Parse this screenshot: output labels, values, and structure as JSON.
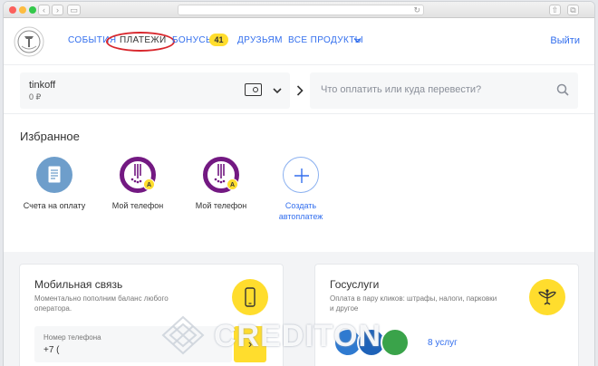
{
  "nav": {
    "items": [
      {
        "label": "События",
        "active": false
      },
      {
        "label": "Платежи",
        "active": true
      },
      {
        "label": "Бонусы",
        "active": false
      },
      {
        "label": "Друзьям",
        "active": false
      },
      {
        "label": "Все продукты",
        "active": false
      }
    ],
    "bonus_count": "41",
    "logout": "Выйти"
  },
  "account": {
    "name": "tinkoff",
    "balance": "0 ₽"
  },
  "search": {
    "placeholder": "Что оплатить или куда перевести?"
  },
  "favorites": {
    "title": "Избранное",
    "items": [
      {
        "label": "Счета на оплату",
        "icon": "invoice-icon"
      },
      {
        "label": "Мой телефон",
        "icon": "megafon-icon",
        "badge": "A"
      },
      {
        "label": "Мой телефон",
        "icon": "megafon-icon",
        "badge": "A"
      },
      {
        "label_line1": "Создать",
        "label_line2": "автоплатеж",
        "icon": "plus-icon"
      }
    ]
  },
  "mobile": {
    "title": "Мобильная связь",
    "desc": "Моментально пополним баланс любого оператора.",
    "phone_label": "Номер телефона",
    "phone_value": "+7 (",
    "icon": "smartphone-icon"
  },
  "gosuslugi": {
    "title": "Госуслуги",
    "desc": "Оплата в пару кликов: штрафы, налоги, парковки и другое",
    "more": "8 услуг",
    "icon": "eagle-icon"
  },
  "watermark": "CREDITON",
  "colors": {
    "brand_yellow": "#ffdd2d",
    "link_blue": "#336fee",
    "megafon_purple": "#731982",
    "annotation_red": "#d8262c"
  }
}
